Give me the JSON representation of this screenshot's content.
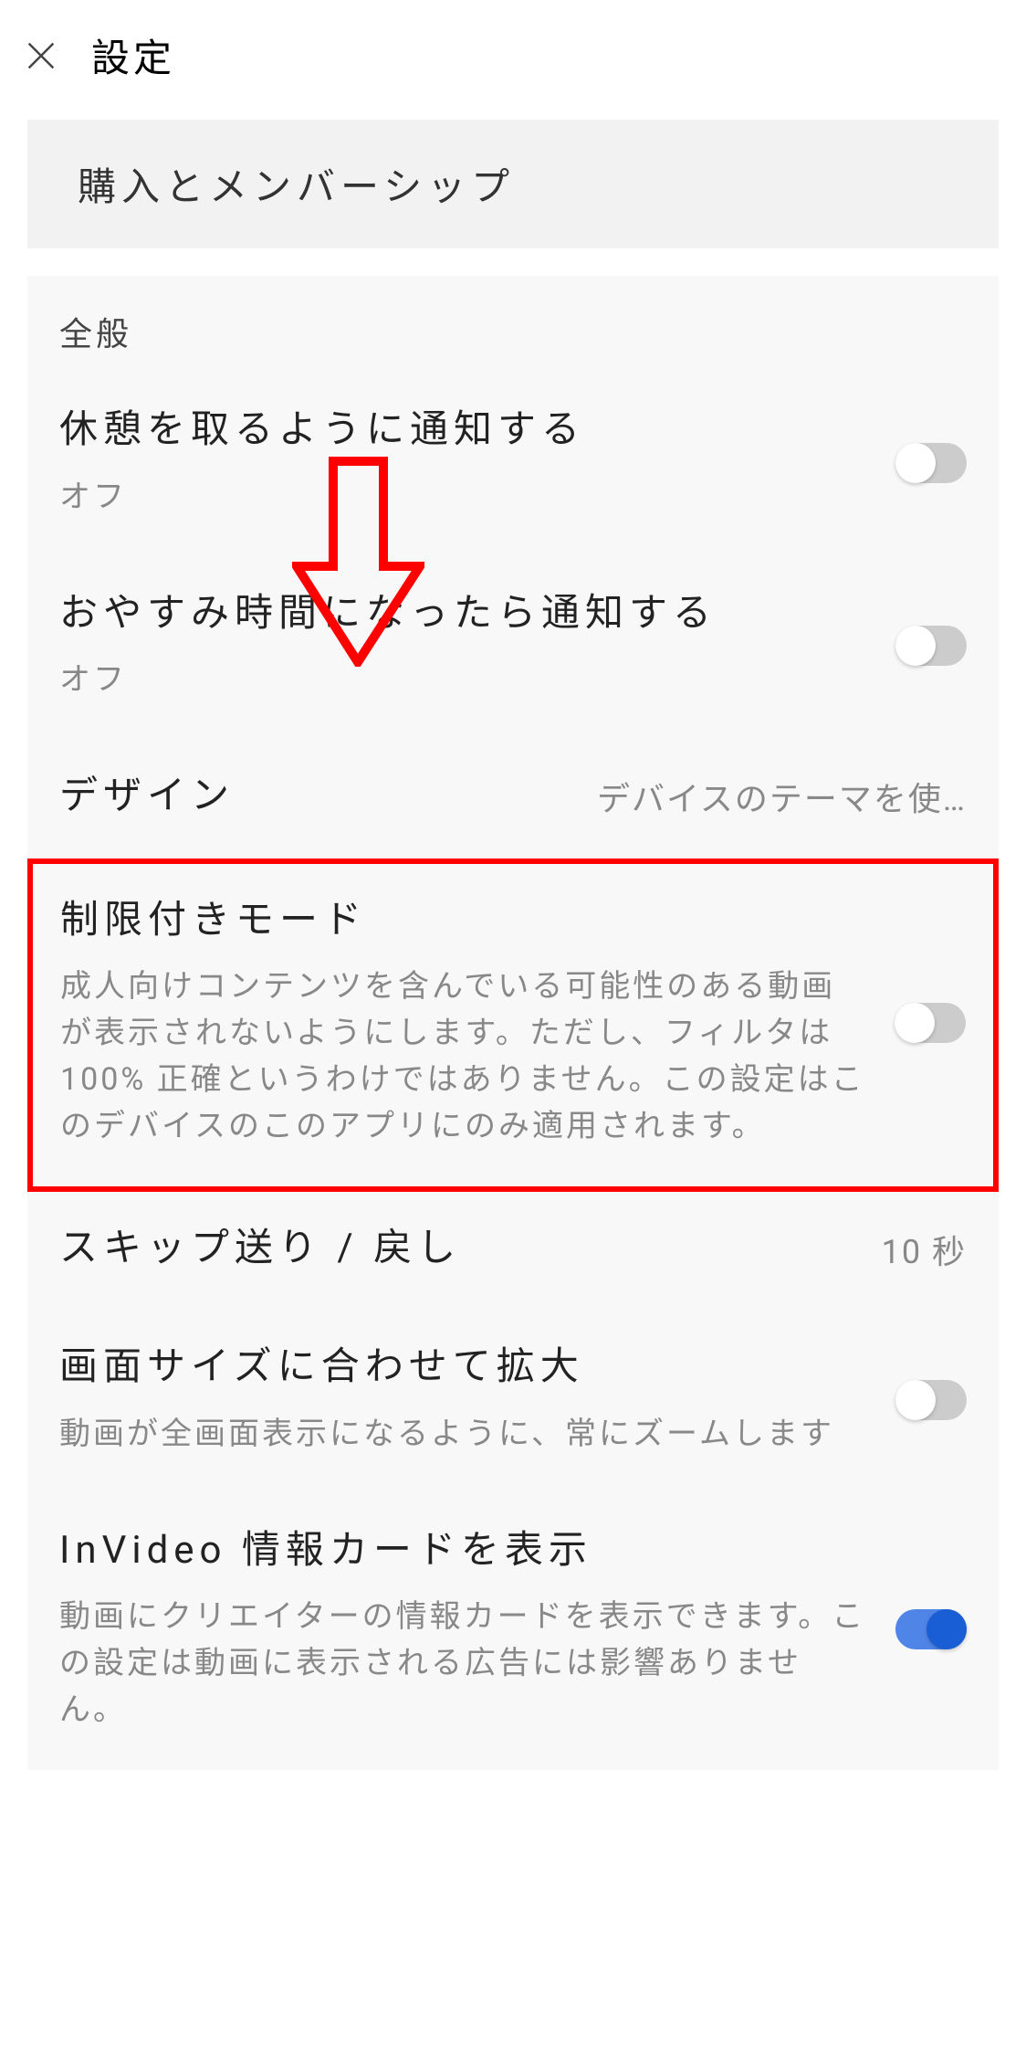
{
  "header": {
    "title": "設定"
  },
  "purchases_button": "購入とメンバーシップ",
  "general": {
    "header": "全般",
    "break": {
      "title": "休憩を取るように通知する",
      "subtitle": "オフ"
    },
    "bedtime": {
      "title": "おやすみ時間になったら通知する",
      "subtitle": "オフ"
    },
    "design": {
      "title": "デザイン",
      "value": "デバイスのテーマを使…"
    },
    "restricted": {
      "title": "制限付きモード",
      "subtitle": "成人向けコンテンツを含んでいる可能性のある動画が表示されないようにします。ただし、フィルタは 100% 正確というわけではありません。この設定はこのデバイスのこのアプリにのみ適用されます。"
    },
    "skip": {
      "title": "スキップ送り / 戻し",
      "value": "10 秒"
    },
    "zoom": {
      "title": "画面サイズに合わせて拡大",
      "subtitle": "動画が全画面表示になるように、常にズームします"
    },
    "invideo": {
      "title": "InVideo 情報カードを表示",
      "subtitle": "動画にクリエイターの情報カードを表示できます。この設定は動画に表示される広告には影響ありません。"
    }
  }
}
